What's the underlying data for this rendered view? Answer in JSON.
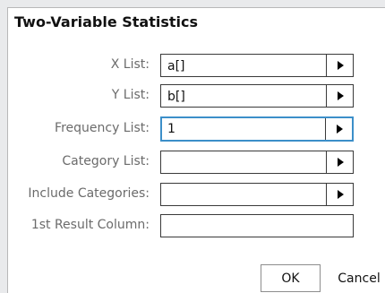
{
  "dialog": {
    "title": "Two-Variable Statistics",
    "fields": [
      {
        "label": "X List:",
        "value": "a[]",
        "has_dropdown": true,
        "focused": false
      },
      {
        "label": "Y List:",
        "value": "b[]",
        "has_dropdown": true,
        "focused": false
      },
      {
        "label": "Frequency List:",
        "value": "1",
        "has_dropdown": true,
        "focused": true
      },
      {
        "label": "Category List:",
        "value": "",
        "has_dropdown": true,
        "focused": false
      },
      {
        "label": "Include Categories:",
        "value": "",
        "has_dropdown": true,
        "focused": false
      },
      {
        "label": "1st Result Column:",
        "value": "",
        "has_dropdown": false,
        "focused": false
      }
    ],
    "buttons": {
      "ok": "OK",
      "cancel": "Cancel"
    }
  },
  "icons": {
    "dropdown": "triangle-right-icon"
  },
  "colors": {
    "focus_border": "#3c8fc9",
    "label_text": "#6b6b6b"
  }
}
